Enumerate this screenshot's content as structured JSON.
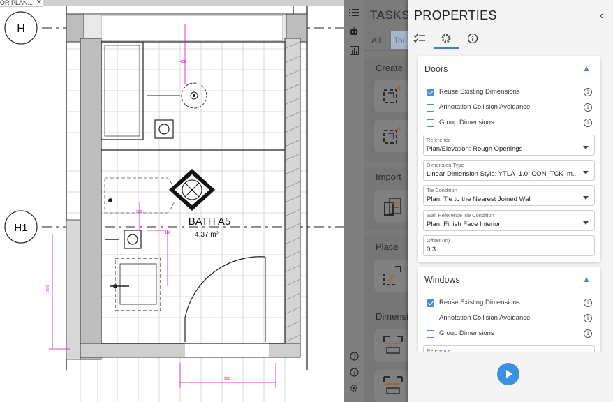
{
  "tab": {
    "title": "OR PLAN...",
    "close": "✕"
  },
  "drawing": {
    "grid_h": "H",
    "grid_h1": "H1",
    "room_name": "BATH A5",
    "room_area": "4.37 m²"
  },
  "rail": {
    "icons": [
      "list-icon",
      "robot-icon",
      "chart-icon",
      "help-icon",
      "info-icon",
      "gear-icon"
    ]
  },
  "tasks": {
    "title": "TASKS",
    "tabs": [
      "All",
      "Tol"
    ],
    "sections": [
      "Create",
      "Import",
      "Place",
      "Dimensi"
    ]
  },
  "properties": {
    "title": "PROPERTIES",
    "collapse": "‹",
    "doors": {
      "header": "Doors",
      "checks": [
        {
          "label": "Reuse Existing Dimensions",
          "checked": true
        },
        {
          "label": "Annotation Collision Avoidance",
          "checked": false
        },
        {
          "label": "Group Dimensions",
          "checked": false
        }
      ],
      "fields": [
        {
          "caption": "Reference",
          "value": "Plan/Elevation: Rough Openings"
        },
        {
          "caption": "Dimension Type",
          "value": "Linear Dimension Style: YTLA_1.0_CON_TCK_m..."
        },
        {
          "caption": "Tie Condition",
          "value": "Plan: Tie to the Nearest Joined Wall"
        },
        {
          "caption": "Wall Reference Tie Condition",
          "value": "Plan: Finish Face Interior"
        },
        {
          "caption": "Offset (m)",
          "value": "0.3"
        }
      ]
    },
    "windows": {
      "header": "Windows",
      "checks": [
        {
          "label": "Reuse Existing Dimensions",
          "checked": true
        },
        {
          "label": "Annotation Collision Avoidance",
          "checked": false
        },
        {
          "label": "Group Dimensions",
          "checked": false
        }
      ],
      "fields": [
        {
          "caption": "Reference",
          "value": ""
        }
      ]
    }
  },
  "colors": {
    "accent": "#3b92e0",
    "dim_line": "#e000e0"
  }
}
